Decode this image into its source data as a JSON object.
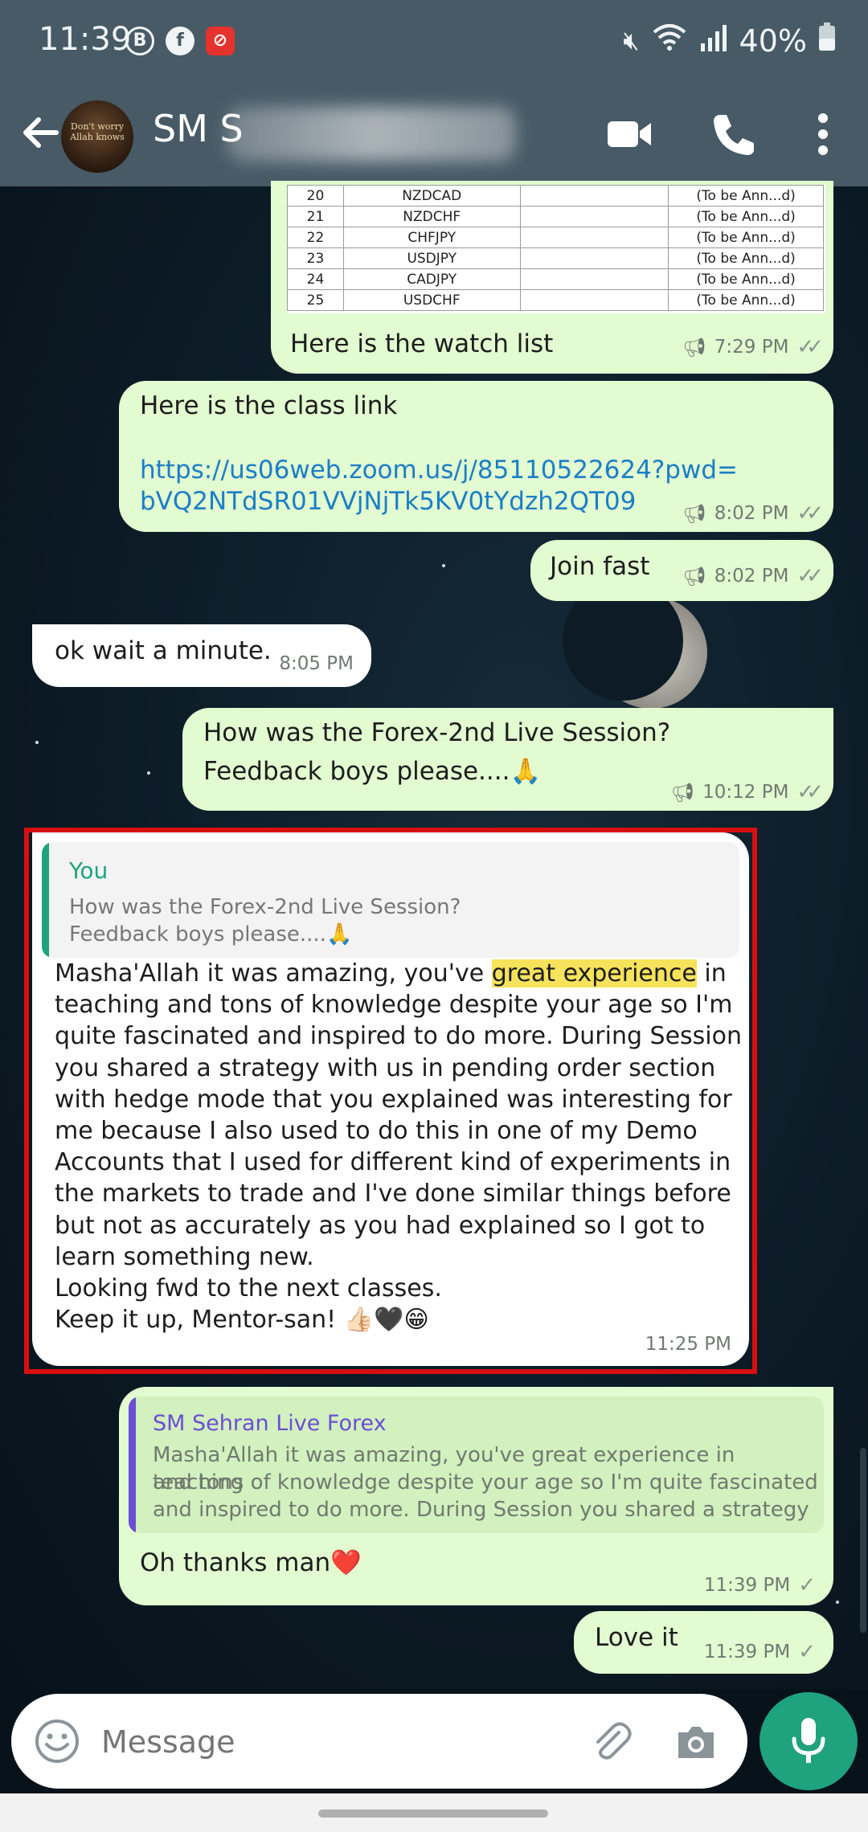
{
  "status_bar": {
    "time": "11:39",
    "icons": [
      "b-icon",
      "facebook-icon",
      "app-icon"
    ],
    "battery": "40%"
  },
  "app_bar": {
    "contact_name_visible": "SM S",
    "icons": [
      "video-call-icon",
      "voice-call-icon",
      "more-icon"
    ]
  },
  "watch_table": {
    "rows": [
      {
        "num": "20",
        "pair": "NZDCAD",
        "note": "(To be Ann...d)"
      },
      {
        "num": "21",
        "pair": "NZDCHF",
        "note": "(To be Ann...d)"
      },
      {
        "num": "22",
        "pair": "CHFJPY",
        "note": "(To be Ann...d)"
      },
      {
        "num": "23",
        "pair": "USDJPY",
        "note": "(To be Ann...d)"
      },
      {
        "num": "24",
        "pair": "CADJPY",
        "note": "(To be Ann...d)"
      },
      {
        "num": "25",
        "pair": "USDCHF",
        "note": "(To be Ann...d)"
      }
    ]
  },
  "messages": [
    {
      "id": "m1",
      "caption": "Here is the watch list",
      "time": "7:29 PM"
    },
    {
      "id": "m2",
      "line1": "Here is the class link",
      "link1": "https://us06web.zoom.us/j/85110522624?pwd=",
      "link2": "bVQ2NTdSR01VVjNjTk5KV0tYdzh2QT09",
      "time": "8:02 PM"
    },
    {
      "id": "m3",
      "text": "Join fast",
      "time": "8:02 PM"
    },
    {
      "id": "m4",
      "text": "ok wait a minute.",
      "time": "8:05 PM"
    },
    {
      "id": "m5",
      "line1": "How was the Forex-2nd Live Session?",
      "line2": "Feedback boys please....🙏",
      "time": "10:12 PM"
    },
    {
      "id": "m6",
      "quote_author": "You",
      "quote_line1": "How was the Forex-2nd Live Session?",
      "quote_line2": "Feedback boys please....🙏",
      "pre_highlight": "Masha'Allah it was amazing, you've ",
      "highlight": "great experience",
      "post_highlight": " in",
      "lines": [
        "teaching and tons of knowledge despite your age so I'm",
        "quite fascinated and inspired to do more. During Session",
        "you shared a strategy with us in pending order section",
        "with hedge mode that you explained was interesting for",
        "me because I also used to do this in one of my Demo",
        "Accounts that I used for different kind of experiments in",
        "the markets to trade and I've done similar things before",
        "but not as accurately as you had explained so I got to",
        "learn something new.",
        "Looking fwd to the next classes.",
        "Keep it up, Mentor-san! 👍🏻🖤😁"
      ],
      "time": "11:25 PM"
    },
    {
      "id": "m7",
      "quote_author": "SM Sehran Live Forex",
      "quote_line1": "Masha'Allah it was amazing, you've great experience in teaching",
      "quote_line2": "and tons of knowledge despite your age so I'm quite fascinated",
      "quote_line3": "and inspired to do more. During Session you shared a strategy ...",
      "text": "Oh thanks man❤️",
      "time": "11:39 PM"
    },
    {
      "id": "m8",
      "text": "Love it",
      "time": "11:39 PM"
    }
  ],
  "composer": {
    "placeholder": "Message",
    "icons": [
      "emoji-icon",
      "attach-icon",
      "camera-icon",
      "mic-icon"
    ]
  },
  "colors": {
    "header": "#475a66",
    "outgoing_bubble": "#e2fbd0",
    "incoming_bubble": "#ffffff",
    "link": "#1b7ec7",
    "highlight": "#f7e35b",
    "selection_frame": "#d80f0f",
    "mic_button": "#1fa37e",
    "quote_you": "#1fa37e",
    "quote_contact": "#6a4fd3"
  }
}
